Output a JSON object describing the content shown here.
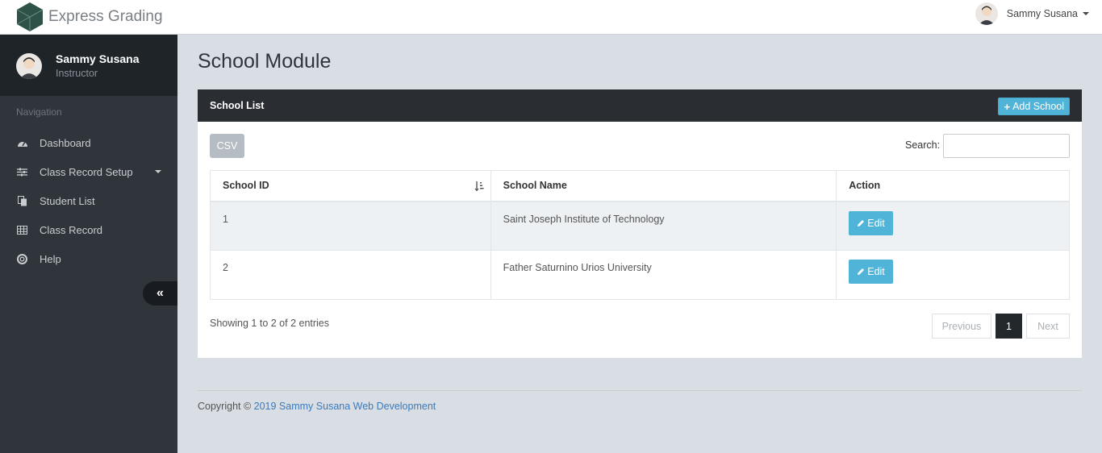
{
  "app": {
    "name": "Express Grading"
  },
  "user": {
    "name": "Sammy Susana",
    "role": "Instructor"
  },
  "sidebar": {
    "nav_title": "Navigation",
    "items": [
      {
        "label": "Dashboard",
        "icon": "dashboard-icon"
      },
      {
        "label": "Class Record Setup",
        "icon": "sliders-icon",
        "has_submenu": true
      },
      {
        "label": "Student List",
        "icon": "files-icon"
      },
      {
        "label": "Class Record",
        "icon": "table-icon"
      },
      {
        "label": "Help",
        "icon": "lifebuoy-icon"
      }
    ],
    "collapse_glyph": "«"
  },
  "page": {
    "title": "School Module"
  },
  "panel": {
    "title": "School List",
    "add_button": "Add School",
    "csv_button": "CSV",
    "search_label": "Search:",
    "search_value": ""
  },
  "table": {
    "columns": [
      "School ID",
      "School Name",
      "Action"
    ],
    "rows": [
      {
        "id": "1",
        "name": "Saint Joseph Institute of Technology",
        "action": "Edit"
      },
      {
        "id": "2",
        "name": "Father Saturnino Urios University",
        "action": "Edit"
      }
    ]
  },
  "pagination": {
    "info": "Showing 1 to 2 of 2 entries",
    "previous": "Previous",
    "current": "1",
    "next": "Next"
  },
  "footer": {
    "prefix": "Copyright © ",
    "link_text": "2019 Sammy Susana Web Development"
  },
  "colors": {
    "sidebar_bg": "#2f353b",
    "panel_header_bg": "#2a2e33",
    "accent": "#4fb4d8",
    "page_bg": "#d9dee4"
  }
}
